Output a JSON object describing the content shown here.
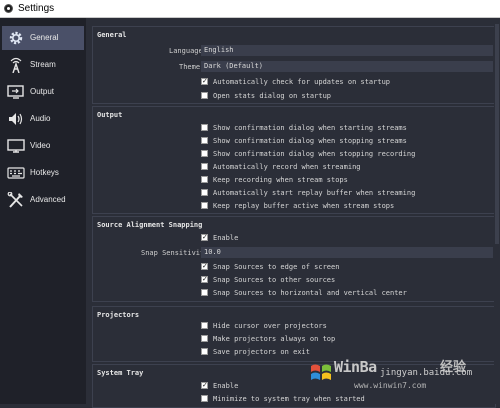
{
  "window": {
    "title": "Settings"
  },
  "sidebar": {
    "items": [
      {
        "label": "General",
        "icon": "gear-icon",
        "active": true
      },
      {
        "label": "Stream",
        "icon": "antenna-icon"
      },
      {
        "label": "Output",
        "icon": "output-monitor-icon"
      },
      {
        "label": "Audio",
        "icon": "speaker-icon"
      },
      {
        "label": "Video",
        "icon": "monitor-icon"
      },
      {
        "label": "Hotkeys",
        "icon": "keyboard-icon"
      },
      {
        "label": "Advanced",
        "icon": "tools-icon"
      }
    ]
  },
  "general": {
    "title": "General",
    "language_label": "Language",
    "language_value": "English",
    "theme_label": "Theme",
    "theme_value": "Dark (Default)",
    "check_updates": {
      "label": "Automatically check for updates on startup",
      "checked": true
    },
    "open_stats": {
      "label": "Open stats dialog on startup",
      "checked": false
    }
  },
  "output": {
    "title": "Output",
    "options": [
      {
        "label": "Show confirmation dialog when starting streams",
        "checked": false
      },
      {
        "label": "Show confirmation dialog when stopping streams",
        "checked": false
      },
      {
        "label": "Show confirmation dialog when stopping recording",
        "checked": false
      },
      {
        "label": "Automatically record when streaming",
        "checked": false
      },
      {
        "label": "Keep recording when stream stops",
        "checked": false
      },
      {
        "label": "Automatically start replay buffer when streaming",
        "checked": false
      },
      {
        "label": "Keep replay buffer active when stream stops",
        "checked": false
      }
    ]
  },
  "snapping": {
    "title": "Source Alignment Snapping",
    "enable": {
      "label": "Enable",
      "checked": true
    },
    "sensitivity_label": "Snap Sensitivity",
    "sensitivity_value": "10.0",
    "options": [
      {
        "label": "Snap Sources to edge of screen",
        "checked": true
      },
      {
        "label": "Snap Sources to other sources",
        "checked": true
      },
      {
        "label": "Snap Sources to horizontal and vertical center",
        "checked": false
      }
    ]
  },
  "projectors": {
    "title": "Projectors",
    "options": [
      {
        "label": "Hide cursor over projectors",
        "checked": false
      },
      {
        "label": "Make projectors always on top",
        "checked": false
      },
      {
        "label": "Save projectors on exit",
        "checked": false
      }
    ]
  },
  "system_tray": {
    "title": "System Tray",
    "options": [
      {
        "label": "Enable",
        "checked": true
      },
      {
        "label": "Minimize to system tray when started",
        "checked": false
      }
    ]
  },
  "watermark": {
    "brand": "WinBa",
    "url": "www.winwin7.com",
    "baidu_text": "经验",
    "baidu_url": "jingyan.baidu.com"
  },
  "checkmark_glyph": "✓"
}
